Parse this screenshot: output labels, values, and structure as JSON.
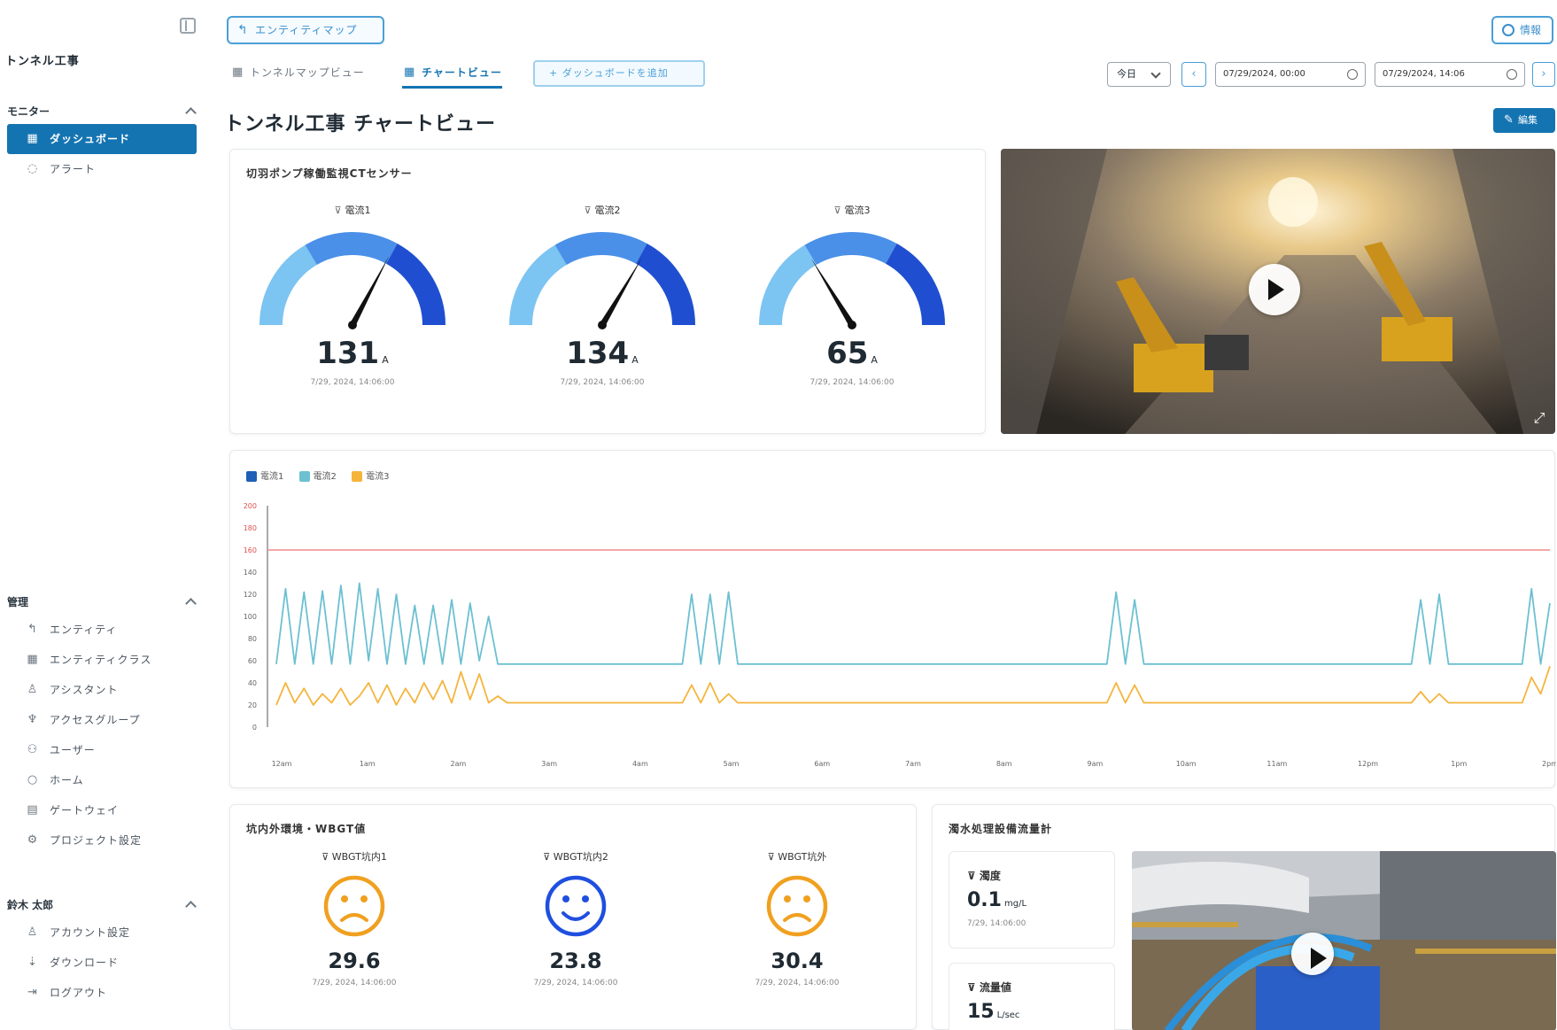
{
  "sidebar": {
    "title": "トンネル工事",
    "sections": [
      {
        "heading": "モニター",
        "items": [
          {
            "label": "ダッシュボード",
            "icon": "dashboard-icon",
            "active": true
          },
          {
            "label": "アラート",
            "icon": "alert-icon",
            "active": false
          }
        ]
      },
      {
        "heading": "管理",
        "items": [
          {
            "label": "エンティティ",
            "icon": "entity-icon"
          },
          {
            "label": "エンティティクラス",
            "icon": "entity-class-icon"
          },
          {
            "label": "アシスタント",
            "icon": "assistant-icon"
          },
          {
            "label": "アクセスグループ",
            "icon": "access-group-icon"
          },
          {
            "label": "ユーザー",
            "icon": "users-icon"
          },
          {
            "label": "ホーム",
            "icon": "home-icon"
          },
          {
            "label": "ゲートウェイ",
            "icon": "gateway-icon"
          },
          {
            "label": "プロジェクト設定",
            "icon": "settings-icon"
          }
        ]
      },
      {
        "heading": "鈴木 太郎",
        "items": [
          {
            "label": "アカウント設定",
            "icon": "account-icon"
          },
          {
            "label": "ダウンロード",
            "icon": "download-icon"
          },
          {
            "label": "ログアウト",
            "icon": "logout-icon"
          }
        ]
      }
    ]
  },
  "topbar": {
    "entity_map": "エンティティマップ",
    "info": "情報",
    "tabs": [
      "トンネルマップビュー",
      "チャートビュー"
    ],
    "add_dashboard": "+ ダッシュボードを追加",
    "range": "今日",
    "start": "07/29/2024, 00:00",
    "end": "07/29/2024, 14:06"
  },
  "page": {
    "title": "トンネル工事 チャートビュー",
    "edit": "編集"
  },
  "gauges": {
    "title": "切羽ポンプ稼働監視CTセンサー",
    "unit": "A",
    "max": 200,
    "items": [
      {
        "label": "電流1",
        "value": 131,
        "value_text": "131",
        "time": "7/29, 2024, 14:06:00"
      },
      {
        "label": "電流2",
        "value": 134,
        "value_text": "134",
        "time": "7/29, 2024, 14:06:00"
      },
      {
        "label": "電流3",
        "value": 65,
        "value_text": "65",
        "time": "7/29, 2024, 14:06:00"
      }
    ],
    "colors": [
      "#7cc4f2",
      "#4a90e8",
      "#1f4fd0"
    ]
  },
  "chart_data": {
    "type": "line",
    "x": [
      "12am",
      "1am",
      "2am",
      "3am",
      "4am",
      "5am",
      "6am",
      "7am",
      "8am",
      "9am",
      "10am",
      "11am",
      "12pm",
      "1pm",
      "2pm"
    ],
    "ylim": [
      0,
      200
    ],
    "yticks": [
      0,
      20,
      40,
      60,
      80,
      100,
      120,
      140,
      160,
      180,
      200
    ],
    "threshold": 160,
    "threshold_color": "#f08a8a",
    "series": [
      {
        "name": "電流1",
        "color": "#1f5fb5",
        "values": []
      },
      {
        "name": "電流2",
        "color": "#6cc0d2",
        "values": [
          57,
          125,
          57,
          122,
          57,
          123,
          57,
          128,
          57,
          130,
          60,
          125,
          57,
          120,
          57,
          110,
          57,
          110,
          57,
          115,
          57,
          112,
          60,
          100,
          57,
          57,
          57,
          57,
          57,
          57,
          57,
          57,
          57,
          57,
          57,
          57,
          57,
          57,
          57,
          57,
          57,
          57,
          57,
          57,
          57,
          120,
          57,
          120,
          57,
          122,
          57,
          57,
          57,
          57,
          57,
          57,
          57,
          57,
          57,
          57,
          57,
          57,
          57,
          57,
          57,
          57,
          57,
          57,
          57,
          57,
          57,
          57,
          57,
          57,
          57,
          57,
          57,
          57,
          57,
          57,
          57,
          57,
          57,
          57,
          57,
          57,
          57,
          57,
          57,
          57,
          57,
          122,
          57,
          115,
          57,
          57,
          57,
          57,
          57,
          57,
          57,
          57,
          57,
          57,
          57,
          57,
          57,
          57,
          57,
          57,
          57,
          57,
          57,
          57,
          57,
          57,
          57,
          57,
          57,
          57,
          57,
          57,
          57,
          57,
          115,
          57,
          120,
          57,
          57,
          57,
          57,
          57,
          57,
          57,
          57,
          57,
          125,
          57,
          112
        ]
      },
      {
        "name": "電流3",
        "color": "#f5b43c",
        "values": [
          20,
          40,
          22,
          35,
          20,
          30,
          22,
          35,
          20,
          28,
          40,
          22,
          38,
          20,
          35,
          22,
          40,
          25,
          42,
          22,
          50,
          25,
          48,
          22,
          28,
          22,
          22,
          22,
          22,
          22,
          22,
          22,
          22,
          22,
          22,
          22,
          22,
          22,
          22,
          22,
          22,
          22,
          22,
          22,
          22,
          38,
          22,
          40,
          22,
          30,
          22,
          22,
          22,
          22,
          22,
          22,
          22,
          22,
          22,
          22,
          22,
          22,
          22,
          22,
          22,
          22,
          22,
          22,
          22,
          22,
          22,
          22,
          22,
          22,
          22,
          22,
          22,
          22,
          22,
          22,
          22,
          22,
          22,
          22,
          22,
          22,
          22,
          22,
          22,
          22,
          22,
          40,
          22,
          38,
          22,
          22,
          22,
          22,
          22,
          22,
          22,
          22,
          22,
          22,
          22,
          22,
          22,
          22,
          22,
          22,
          22,
          22,
          22,
          22,
          22,
          22,
          22,
          22,
          22,
          22,
          22,
          22,
          22,
          22,
          32,
          22,
          30,
          22,
          22,
          22,
          22,
          22,
          22,
          22,
          22,
          22,
          45,
          30,
          55
        ]
      }
    ]
  },
  "wbgt": {
    "title": "坑内外環境・WBGT値",
    "items": [
      {
        "label": "WBGT坑内1",
        "value": "29.6",
        "mood": "sad",
        "color": "#f0a020",
        "time": "7/29, 2024, 14:06:00"
      },
      {
        "label": "WBGT坑内2",
        "value": "23.8",
        "mood": "happy",
        "color": "#1f4fe0",
        "time": "7/29, 2024, 14:06:00"
      },
      {
        "label": "WBGT坑外",
        "value": "30.4",
        "mood": "sad",
        "color": "#f0a020",
        "time": "7/29, 2024, 14:06:00"
      }
    ]
  },
  "water": {
    "title": "濁水処理設備流量計",
    "items": [
      {
        "label": "濁度",
        "value": "0.1",
        "unit": "mg/L",
        "time": "7/29, 14:06:00"
      },
      {
        "label": "流量値",
        "value": "15",
        "unit": "L/sec",
        "time": ""
      }
    ]
  }
}
